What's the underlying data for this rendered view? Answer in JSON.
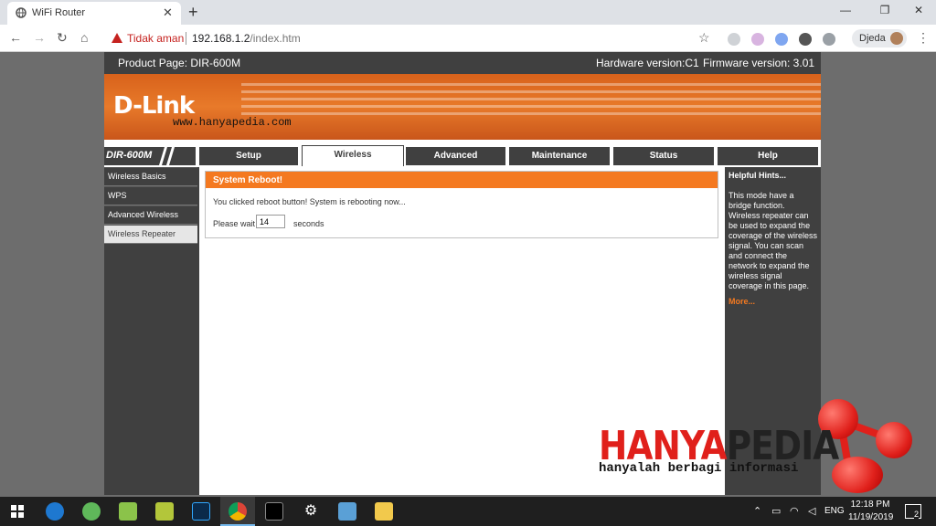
{
  "browser": {
    "tab_title": "WiFi Router",
    "security_label": "Tidak aman",
    "url_host": "192.168.1.2",
    "url_path": "/index.htm",
    "profile_name": "Djeda"
  },
  "router": {
    "product": "Product Page: DIR-600M",
    "hardware": "Hardware version:C1",
    "firmware": "Firmware version: 3.01",
    "logo": "D-Link",
    "watermark_url": "www.hanyapedia.com",
    "model": "DIR-600M",
    "tabs": [
      "Setup",
      "Wireless",
      "Advanced",
      "Maintenance",
      "Status",
      "Help"
    ],
    "active_tab": "Wireless",
    "left_nav": [
      "Wireless Basics",
      "WPS",
      "Advanced Wireless",
      "Wireless Repeater"
    ],
    "active_left": "Wireless Repeater",
    "panel": {
      "title": "System Reboot!",
      "message": "You clicked reboot button! System is rebooting now...",
      "wait_label": "Please wait",
      "wait_value": "14",
      "seconds_label": "seconds"
    },
    "hints": {
      "title": "Helpful Hints...",
      "body": "This mode have a bridge function. Wireless repeater can be used to expand the coverage of the wireless signal. You can scan and connect the network to expand the wireless signal coverage in this page.",
      "more": "More..."
    }
  },
  "watermark": {
    "brand_red": "HANYA",
    "brand_dark": "PEDIA",
    "tagline": "hanyalah berbagi informasi"
  },
  "taskbar": {
    "time": "12:18 PM",
    "date": "11/19/2019",
    "lang": "ENG",
    "notifications": "2"
  },
  "colors": {
    "accent_orange": "#f47920",
    "dark_gray": "#404040",
    "brand_red": "#e0201b"
  }
}
